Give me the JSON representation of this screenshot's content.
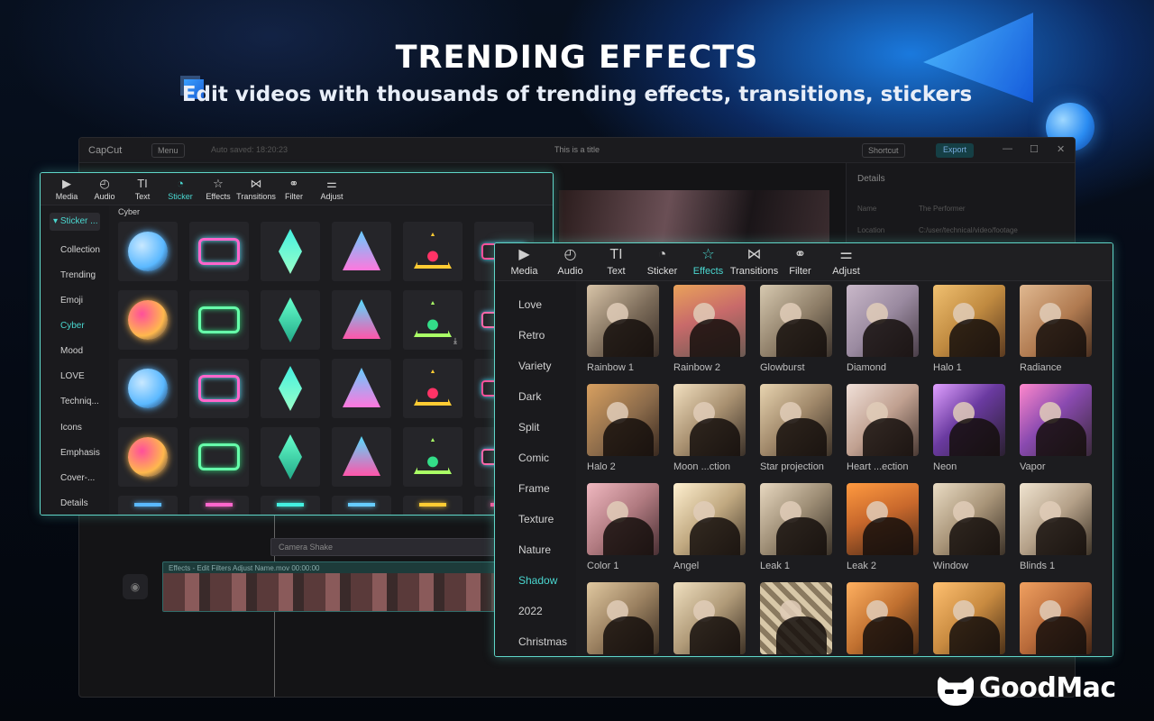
{
  "hero": {
    "title": "TRENDING EFFECTS",
    "subtitle": "Edit videos with thousands of trending effects, transitions, stickers"
  },
  "colors": {
    "accent": "#4ad7d0",
    "panel_border": "#5fd6c8",
    "glow_blue": "#1e8cff"
  },
  "main_window": {
    "app_name": "CapCut",
    "menu_label": "Menu",
    "autosave": "Auto saved: 18:20:23",
    "title": "This is a title",
    "shortcut_label": "Shortcut",
    "export_label": "Export",
    "details": {
      "title": "Details",
      "name_label": "Name",
      "name_value": "The Performer",
      "location_label": "Location",
      "location_value": "C:/user/technical/video/footage"
    },
    "track_label": "Camera Shake",
    "clip_label": "Effects - Edit   Filters   Adjust   Name.mov  00:00:00"
  },
  "sticker_panel": {
    "tabs": [
      {
        "label": "Media",
        "icon": "media-icon"
      },
      {
        "label": "Audio",
        "icon": "audio-icon"
      },
      {
        "label": "Text",
        "icon": "text-icon"
      },
      {
        "label": "Sticker",
        "icon": "sticker-icon"
      },
      {
        "label": "Effects",
        "icon": "effects-icon"
      },
      {
        "label": "Transitions",
        "icon": "transitions-icon"
      },
      {
        "label": "Filter",
        "icon": "filter-icon"
      },
      {
        "label": "Adjust",
        "icon": "adjust-icon"
      }
    ],
    "active_tab": "Sticker",
    "sidebar_head": "Sticker ...",
    "sidebar": [
      "Collection",
      "Trending",
      "Emoji",
      "Cyber",
      "Mood",
      "LOVE",
      "Techniq...",
      "Icons",
      "Emphasis",
      "Cover-...",
      "Details"
    ],
    "active_category": "Cyber",
    "section_label": "Cyber"
  },
  "effects_panel": {
    "tabs": [
      {
        "label": "Media",
        "icon": "media-icon"
      },
      {
        "label": "Audio",
        "icon": "audio-icon"
      },
      {
        "label": "Text",
        "icon": "text-icon"
      },
      {
        "label": "Sticker",
        "icon": "sticker-icon"
      },
      {
        "label": "Effects",
        "icon": "effects-icon"
      },
      {
        "label": "Transitions",
        "icon": "transitions-icon"
      },
      {
        "label": "Filter",
        "icon": "filter-icon"
      },
      {
        "label": "Adjust",
        "icon": "adjust-icon"
      }
    ],
    "active_tab": "Effects",
    "sidebar": [
      "Love",
      "Retro",
      "Variety",
      "Dark",
      "Split",
      "Comic",
      "Frame",
      "Texture",
      "Nature",
      "Shadow",
      "2022",
      "Christmas"
    ],
    "active_category": "Shadow",
    "effects": [
      "Rainbow 1",
      "Rainbow 2",
      "Glowburst",
      "Diamond",
      "Halo 1",
      "Radiance",
      "Halo 2",
      "Moon ...ction",
      "Star projection",
      "Heart ...ection",
      "Neon",
      "Vapor",
      "Color 1",
      "Angel",
      "Leak 1",
      "Leak 2",
      "Window",
      "Blinds 1",
      "",
      "",
      "",
      "",
      "",
      ""
    ]
  },
  "brand": {
    "name": "GoodMac",
    "icon": "goodmac-logo-icon"
  }
}
